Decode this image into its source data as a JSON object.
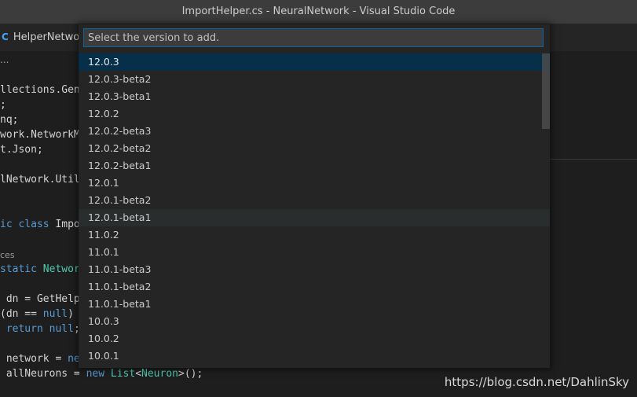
{
  "window": {
    "title": "ImportHelper.cs - NeuralNetwork - Visual Studio Code"
  },
  "tabs": [
    {
      "label": "HelperNetwor",
      "icon": "csharp-icon"
    }
  ],
  "breadcrumb": {
    "text": "..."
  },
  "editor": {
    "lines": [
      "llections.Gene",
      ";",
      "nq;",
      "work.NetworkMo",
      "t.Json;",
      "",
      "lNetwork.Util",
      "",
      "",
      "ic class Impo",
      "",
      "ces",
      "static Network",
      "",
      " dn = GetHelpe",
      "(dn == null)",
      " return null;",
      "",
      " network = new",
      " allNeurons = new List<Neuron>();"
    ]
  },
  "quickpick": {
    "placeholder": "Select the version to add.",
    "value": "",
    "items": [
      "12.0.3",
      "12.0.3-beta2",
      "12.0.3-beta1",
      "12.0.2",
      "12.0.2-beta3",
      "12.0.2-beta2",
      "12.0.2-beta1",
      "12.0.1",
      "12.0.1-beta2",
      "12.0.1-beta1",
      "11.0.2",
      "11.0.1",
      "11.0.1-beta3",
      "11.0.1-beta2",
      "11.0.1-beta1",
      "10.0.3",
      "10.0.2",
      "10.0.1"
    ],
    "selected_index": 0,
    "hover_index": 9
  },
  "watermark": {
    "text": "https://blog.csdn.net/DahlinSky"
  },
  "colors": {
    "accent": "#0e639c",
    "selection": "#062f4a",
    "editor_bg": "#1e1e1e",
    "widget_bg": "#252526"
  }
}
